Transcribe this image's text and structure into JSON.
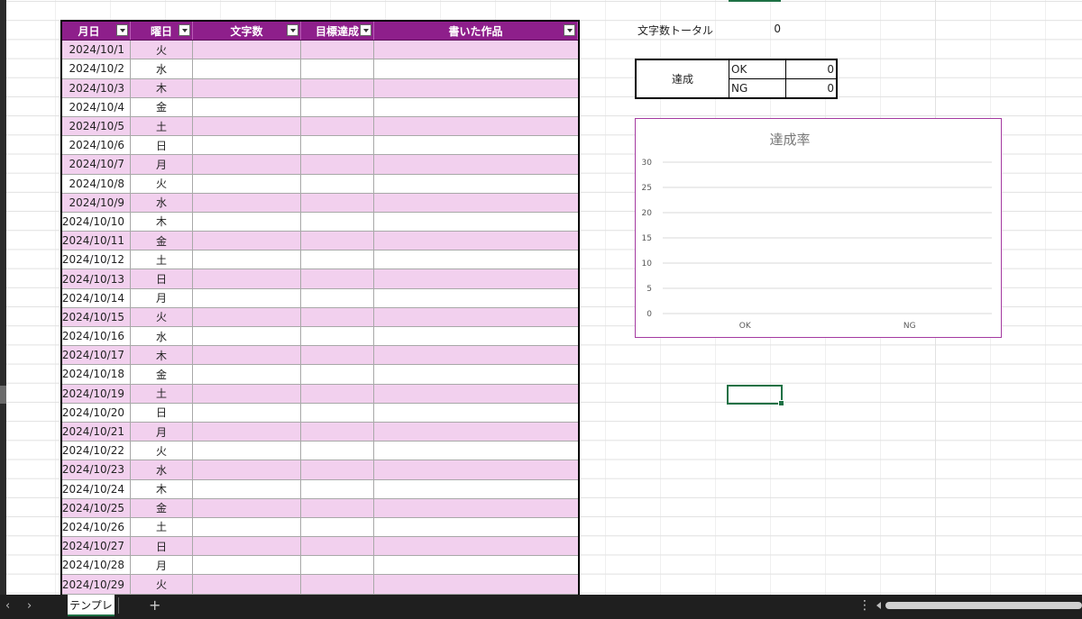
{
  "table": {
    "headers": {
      "date": "月日",
      "day": "曜日",
      "chars": "文字数",
      "goal": "目標達成",
      "works": "書いた作品"
    },
    "rows": [
      {
        "date": "2024/10/1",
        "day": "火"
      },
      {
        "date": "2024/10/2",
        "day": "水"
      },
      {
        "date": "2024/10/3",
        "day": "木"
      },
      {
        "date": "2024/10/4",
        "day": "金"
      },
      {
        "date": "2024/10/5",
        "day": "土"
      },
      {
        "date": "2024/10/6",
        "day": "日"
      },
      {
        "date": "2024/10/7",
        "day": "月"
      },
      {
        "date": "2024/10/8",
        "day": "火"
      },
      {
        "date": "2024/10/9",
        "day": "水"
      },
      {
        "date": "2024/10/10",
        "day": "木"
      },
      {
        "date": "2024/10/11",
        "day": "金"
      },
      {
        "date": "2024/10/12",
        "day": "土"
      },
      {
        "date": "2024/10/13",
        "day": "日"
      },
      {
        "date": "2024/10/14",
        "day": "月"
      },
      {
        "date": "2024/10/15",
        "day": "火"
      },
      {
        "date": "2024/10/16",
        "day": "水"
      },
      {
        "date": "2024/10/17",
        "day": "木"
      },
      {
        "date": "2024/10/18",
        "day": "金"
      },
      {
        "date": "2024/10/19",
        "day": "土"
      },
      {
        "date": "2024/10/20",
        "day": "日"
      },
      {
        "date": "2024/10/21",
        "day": "月"
      },
      {
        "date": "2024/10/22",
        "day": "火"
      },
      {
        "date": "2024/10/23",
        "day": "水"
      },
      {
        "date": "2024/10/24",
        "day": "木"
      },
      {
        "date": "2024/10/25",
        "day": "金"
      },
      {
        "date": "2024/10/26",
        "day": "土"
      },
      {
        "date": "2024/10/27",
        "day": "日"
      },
      {
        "date": "2024/10/28",
        "day": "月"
      },
      {
        "date": "2024/10/29",
        "day": "火"
      }
    ]
  },
  "total": {
    "label": "文字数トータル",
    "value": "0"
  },
  "summary": {
    "label": "達成",
    "ok_label": "OK",
    "ok_value": "0",
    "ng_label": "NG",
    "ng_value": "0"
  },
  "chart_data": {
    "type": "bar",
    "title": "達成率",
    "categories": [
      "OK",
      "NG"
    ],
    "values": [
      0,
      0
    ],
    "ylim": [
      0,
      30
    ],
    "yticks": [
      0,
      5,
      10,
      15,
      20,
      25,
      30
    ],
    "grid": true
  },
  "sheet": {
    "tab": "テンプレ",
    "add": "+",
    "menu": "⋮",
    "prev": "‹",
    "next": "›"
  },
  "colors": {
    "header": "#8e1f8b",
    "stripe": "#f2d0ee",
    "chart_border": "#a43aa0",
    "selection": "#1e7145"
  }
}
